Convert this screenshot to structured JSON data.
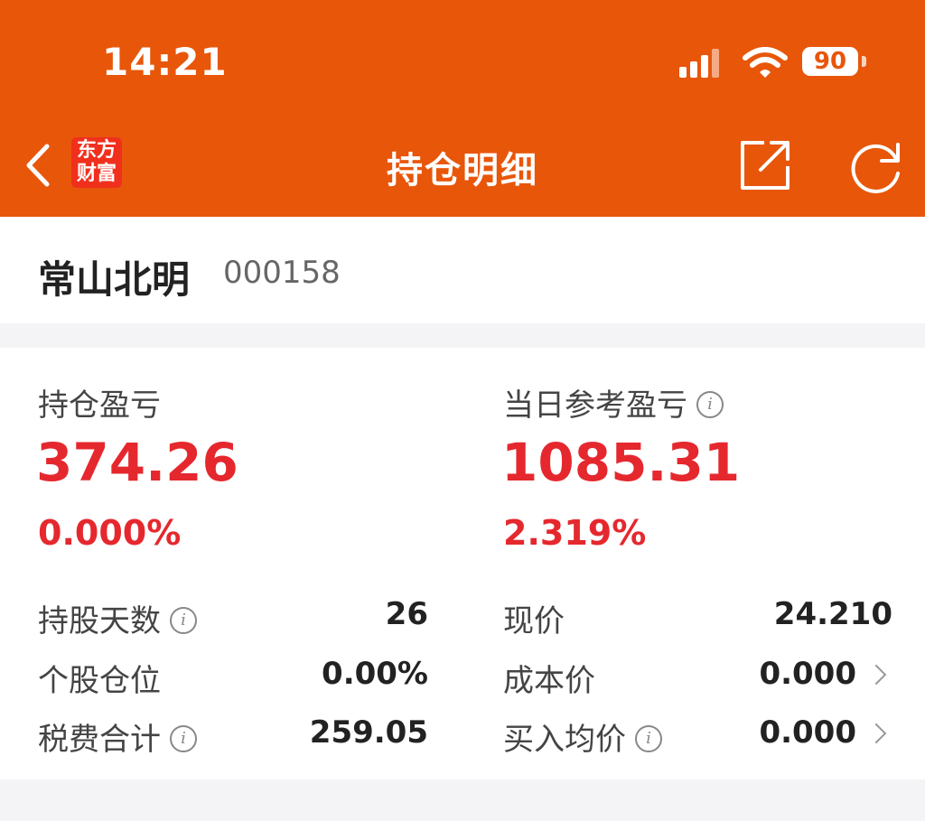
{
  "status_bar": {
    "time": "14:21",
    "battery": "90"
  },
  "header": {
    "logo_line1": "东方",
    "logo_line2": "财富",
    "title": "持仓明细"
  },
  "stock": {
    "name": "常山北明",
    "code": "000158"
  },
  "summary": {
    "holding_pl_label": "持仓盈亏",
    "holding_pl_value": "374.26",
    "holding_pl_pct": "0.000%",
    "daily_pl_label": "当日参考盈亏",
    "daily_pl_value": "1085.31",
    "daily_pl_pct": "2.319%"
  },
  "details": {
    "left": [
      {
        "label": "持股天数",
        "value": "26"
      },
      {
        "label": "个股仓位",
        "value": "0.00%"
      },
      {
        "label": "税费合计",
        "value": "259.05"
      }
    ],
    "right": [
      {
        "label": "现价",
        "value": "24.210"
      },
      {
        "label": "成本价",
        "value": "0.000"
      },
      {
        "label": "买入均价",
        "value": "0.000"
      }
    ]
  },
  "colors": {
    "header_bg": "#e8560a",
    "gain_red": "#e5282e",
    "logo_red": "#f0301d"
  },
  "icons": {
    "back": "chevron-left-icon",
    "share": "share-icon",
    "refresh": "refresh-icon",
    "info": "info-icon",
    "row_chevron": "chevron-right-icon"
  }
}
